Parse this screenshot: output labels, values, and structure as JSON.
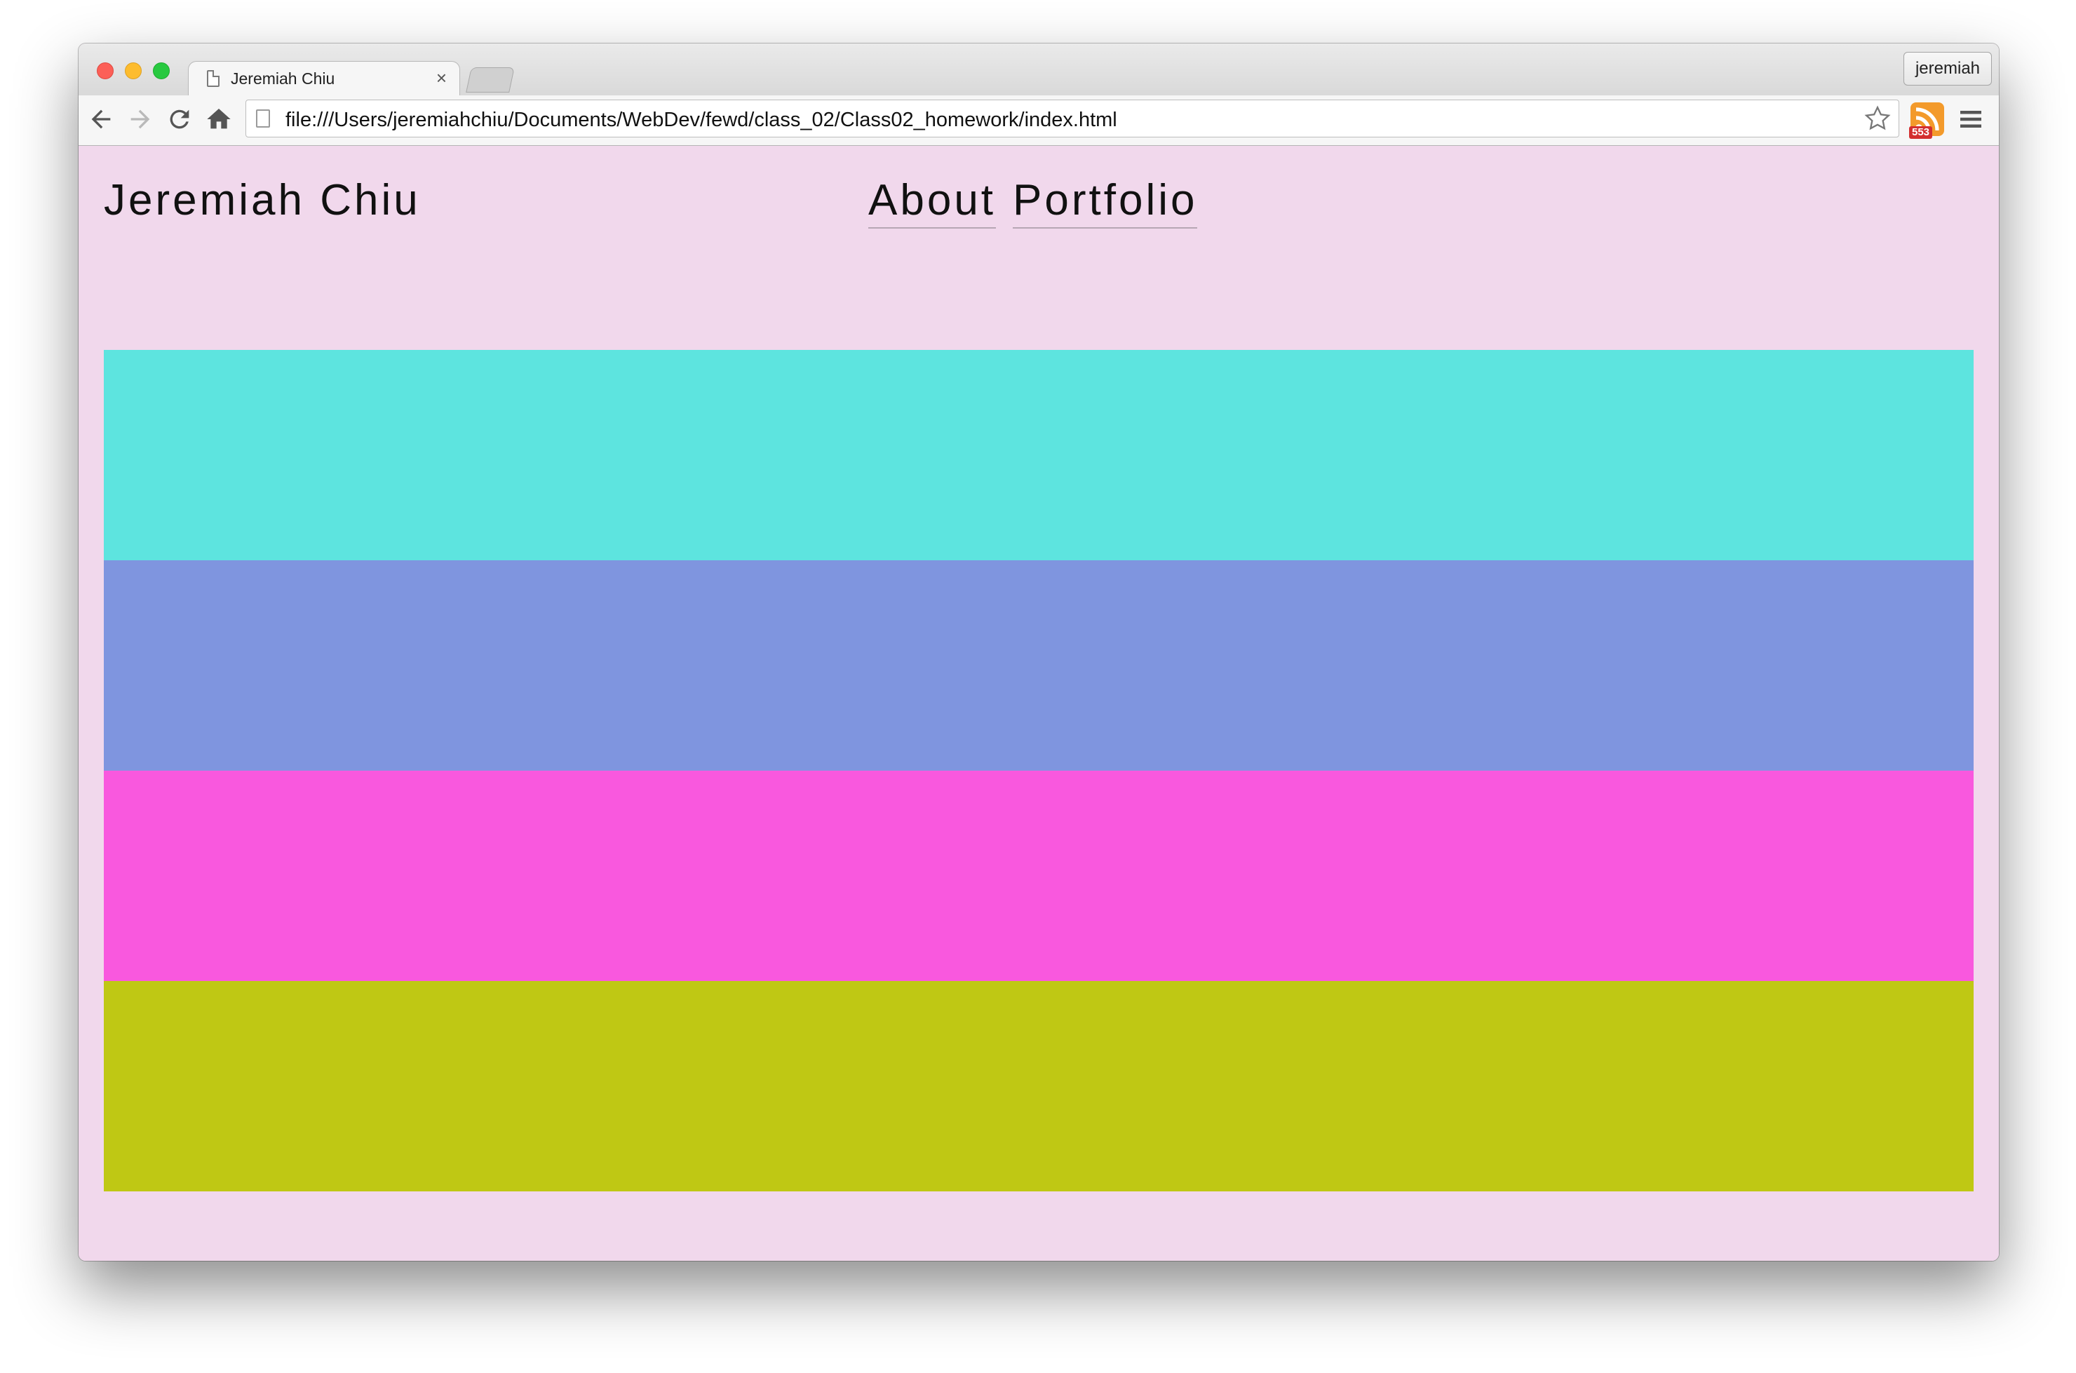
{
  "browser": {
    "tab": {
      "title": "Jeremiah Chiu",
      "close_glyph": "×"
    },
    "profile_name": "jeremiah",
    "address_bar": {
      "url": "file:///Users/jeremiahchiu/Documents/WebDev/fewd/class_02/Class02_homework/index.html"
    },
    "toolbar_icons": [
      "back-arrow-icon",
      "forward-arrow-icon",
      "reload-icon",
      "home-icon",
      "bookmark-star-icon",
      "rss-icon",
      "menu-icon"
    ],
    "extension_badge": "553"
  },
  "page": {
    "site_title": "Jeremiah Chiu",
    "nav": [
      {
        "label": "About"
      },
      {
        "label": "Portfolio"
      }
    ],
    "background": "#f1d8ec",
    "stripes": [
      {
        "color": "#5de4df"
      },
      {
        "color": "#7f95df"
      },
      {
        "color": "#f958de"
      },
      {
        "color": "#bfc814"
      }
    ]
  }
}
